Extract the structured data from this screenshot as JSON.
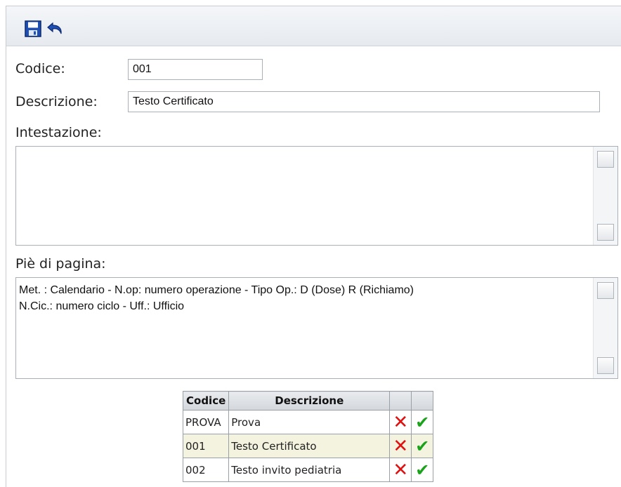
{
  "toolbar": {
    "save_icon": "floppy-disk-icon",
    "undo_icon": "undo-arrow-icon"
  },
  "form": {
    "codice_label": "Codice:",
    "codice_value": "001",
    "descrizione_label": "Descrizione:",
    "descrizione_value": "Testo Certificato",
    "intestazione_label": "Intestazione:",
    "intestazione_value": "",
    "piede_label": "Piè di pagina:",
    "piede_value": "Met. : Calendario - N.op: numero operazione - Tipo Op.: D (Dose) R (Richiamo)\nN.Cic.: numero ciclo - Uff.: Ufficio"
  },
  "table": {
    "headers": [
      "Codice",
      "Descrizione",
      "",
      ""
    ],
    "rows": [
      {
        "codice": "PROVA",
        "descrizione": "Prova",
        "delete_icon": "delete-x-icon",
        "select_icon": "checkmark-icon"
      },
      {
        "codice": "001",
        "descrizione": "Testo Certificato",
        "delete_icon": "delete-x-icon",
        "select_icon": "checkmark-icon"
      },
      {
        "codice": "002",
        "descrizione": "Testo invito pediatria",
        "delete_icon": "delete-x-icon",
        "select_icon": "checkmark-icon"
      }
    ]
  },
  "colors": {
    "toolbar_bg": "#e6eaef",
    "highlight_row": "#f4f3df",
    "delete_red": "#e01010",
    "check_green": "#1aa31a",
    "icon_blue": "#1f4fb5"
  }
}
